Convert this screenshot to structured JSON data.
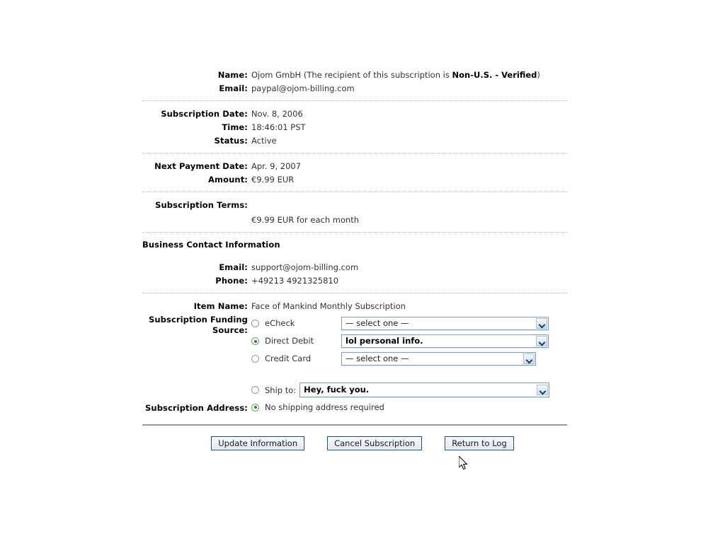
{
  "account": {
    "name_label": "Name:",
    "name_value_main": "Ojom GmbH (The recipient of this subscription is ",
    "name_value_status": "Non-U.S. - Verified",
    "name_value_close": ")",
    "email_label": "Email:",
    "email_value": "paypal@ojom-billing.com"
  },
  "subscription": {
    "date_label": "Subscription Date:",
    "date_value": "Nov. 8, 2006",
    "time_label": "Time:",
    "time_value": "18:46:01 PST",
    "status_label": "Status:",
    "status_value": "Active"
  },
  "payment": {
    "next_payment_label": "Next Payment Date:",
    "next_payment_value": "Apr. 9, 2007",
    "amount_label": "Amount:",
    "amount_value": "€9.99 EUR"
  },
  "terms": {
    "label": "Subscription Terms:",
    "value": "€9.99 EUR for each month"
  },
  "business_contact": {
    "heading": "Business Contact Information",
    "email_label": "Email:",
    "email_value": "support@ojom-billing.com",
    "phone_label": "Phone:",
    "phone_value": "+49213 4921325810"
  },
  "item": {
    "label": "Item Name:",
    "value": "Face of Mankind Monthly Subscription"
  },
  "funding": {
    "label_line1": "Subscription Funding",
    "label_line2": "Source:",
    "options": [
      {
        "label": "eCheck",
        "selected": false,
        "select_value": "— select one —",
        "select_bold": false
      },
      {
        "label": "Direct Debit",
        "selected": true,
        "select_value": "lol personal info.",
        "select_bold": true
      },
      {
        "label": "Credit Card",
        "selected": false,
        "select_value": "— select one —",
        "select_bold": false
      }
    ]
  },
  "address": {
    "label": "Subscription Address:",
    "ship_to_label": "Ship to:",
    "ship_to_value": "Hey, fuck you.",
    "ship_to_selected": false,
    "no_shipping_label": "No shipping address required",
    "no_shipping_selected": true
  },
  "buttons": {
    "update": "Update Information",
    "cancel": "Cancel Subscription",
    "return": "Return to Log"
  }
}
